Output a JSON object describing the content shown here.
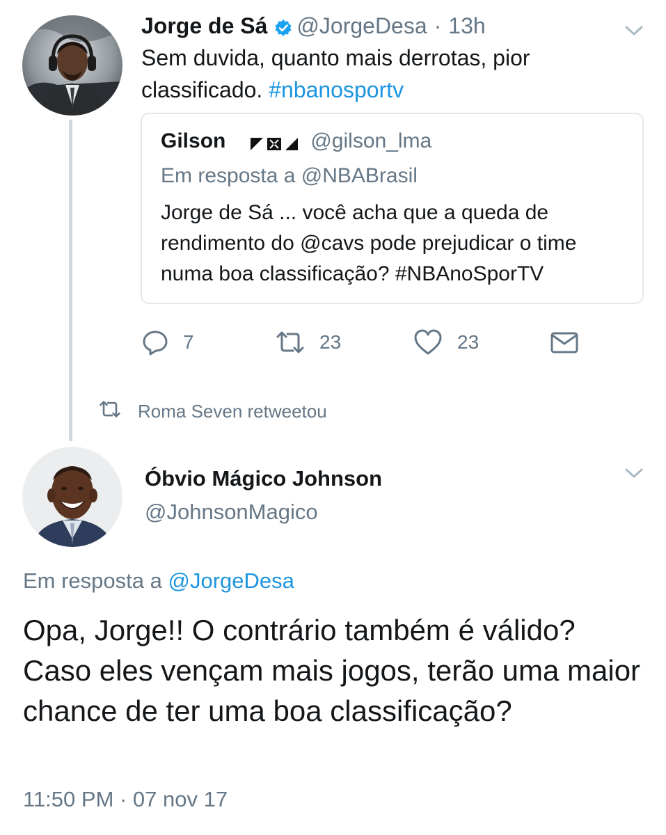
{
  "tweet1": {
    "author_name": "Jorge de Sá",
    "handle": "@JorgeDesa",
    "separator": "·",
    "time": "13h",
    "text_before_hashtag": "Sem duvida, quanto mais derrotas, pior classificado. ",
    "hashtag": "#nbanosportv",
    "verified_icon": "verified-badge-icon",
    "menu_icon": "chevron-down-icon"
  },
  "quoted": {
    "author_name": "Gilson",
    "flag_icon": "vasco-flag-icon",
    "handle": "@gilson_lma",
    "reply_to": "Em resposta a @NBABrasil",
    "text": "Jorge de Sá ... você acha que a queda de rendimento do @cavs pode prejudicar o time numa boa classificação? #NBAnoSporTV"
  },
  "actions": {
    "reply_count": "7",
    "retweet_count": "23",
    "like_count": "23",
    "reply_icon": "reply-icon",
    "retweet_icon": "retweet-icon",
    "like_icon": "heart-icon",
    "dm_icon": "envelope-icon"
  },
  "retweet_notice": {
    "text": "Roma Seven retweetou",
    "icon": "retweet-icon"
  },
  "tweet2": {
    "author_name": "Óbvio Mágico Johnson",
    "handle": "@JohnsonMagico",
    "reply_prefix": "Em resposta a ",
    "reply_handle": "@JorgeDesa",
    "text": "Opa, Jorge!! O contrário também é válido? Caso eles vençam mais jogos, terão uma maior chance de ter uma boa classificação?",
    "timestamp": "11:50 PM · 07 nov 17",
    "menu_icon": "chevron-down-icon"
  },
  "colors": {
    "link": "#1b95e0",
    "secondary_text": "#657786",
    "primary_text": "#14171a",
    "border": "#e1e8ed",
    "thread_line": "#cfd9de"
  }
}
